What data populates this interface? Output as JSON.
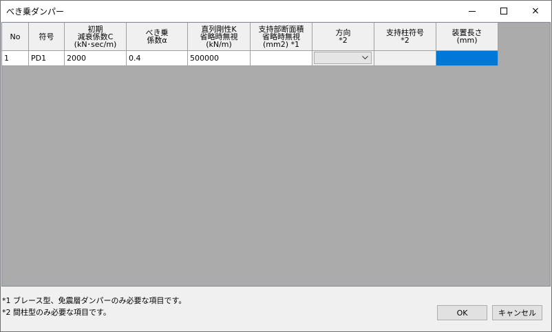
{
  "window": {
    "title": "べき乗ダンパー",
    "controls": {
      "minimize": "minimize",
      "maximize": "maximize",
      "close": "×"
    }
  },
  "grid": {
    "columns": [
      "No",
      "符号",
      "初期\n減衰係数C\n(kN･sec/m)",
      "べき乗\n係数α",
      "直列剛性K\n省略時無視\n(kN/m)",
      "支持部断面積\n省略時無視\n(mm2) *1",
      "方向\n*2",
      "支持柱符号\n*2",
      "装置長さ\n(mm)"
    ],
    "rows": [
      {
        "no": "1",
        "symbol": "PD1",
        "damping": "2000",
        "alpha": "0.4",
        "stiffness": "500000",
        "area": "",
        "direction": "",
        "column_symbol": "",
        "length": ""
      }
    ]
  },
  "notes": [
    "*1 ブレース型、免震層ダンパーのみ必要な項目です。",
    "*2 間柱型のみ必要な項目です。"
  ],
  "buttons": {
    "ok": "OK",
    "cancel": "キャンセル"
  },
  "colors": {
    "grid_background": "#ababab",
    "selection": "#0078d7"
  }
}
